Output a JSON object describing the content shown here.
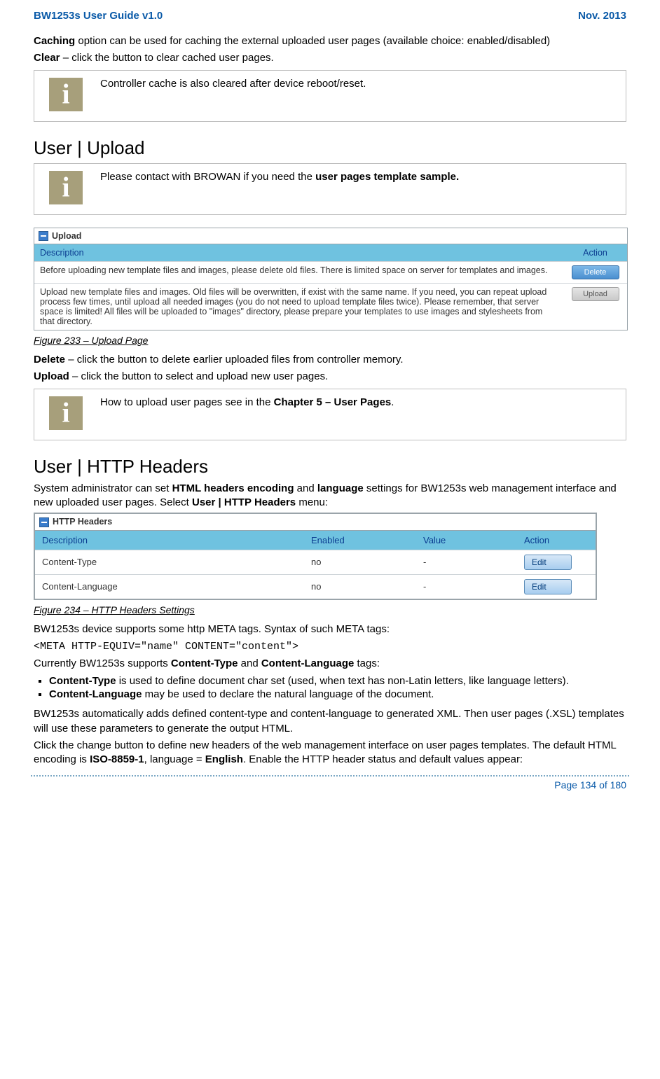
{
  "header": {
    "left": "BW1253s User Guide v1.0",
    "right": "Nov.  2013"
  },
  "intro": {
    "caching_label": "Caching",
    "caching_desc": " option can be used for caching the external uploaded user pages (available choice: enabled/disabled)",
    "clear_label": "Clear",
    "clear_desc": " – click the button to clear cached user pages."
  },
  "info1": "Controller cache is also cleared after device reboot/reset.",
  "upload": {
    "heading": "User | Upload",
    "info_prefix": "Please contact with BROWAN if you need the ",
    "info_bold": "user pages template sample.",
    "panel_title": "Upload",
    "col_desc": "Description",
    "col_action": "Action",
    "row1_text": "Before uploading new template files and images, please delete old files. There is limited space on server for templates and images.",
    "row1_btn": "Delete",
    "row2_text": "Upload new template files and images. Old files will be overwritten, if exist with the same name. If you need, you can repeat upload process few times, until upload all needed images (you do not need to upload template files twice). Please remember, that server space is limited! All files will be uploaded to \"images\" directory, please prepare your templates to use images and stylesheets from that directory.",
    "row2_btn": "Upload",
    "caption": "Figure 233 – Upload Page",
    "delete_label": "Delete",
    "delete_desc": " – click the button to delete earlier uploaded files from controller memory.",
    "upload_label": "Upload",
    "upload_desc": " – click the button to select and upload new user pages.",
    "howto_prefix": "How to upload user pages see in the ",
    "howto_bold": "Chapter 5 – User Pages",
    "howto_suffix": "."
  },
  "http": {
    "heading": "User | HTTP Headers",
    "intro_pre": "System administrator can set ",
    "intro_b1": "HTML headers encoding",
    "intro_mid1": " and ",
    "intro_b2": "language",
    "intro_mid2": " settings for BW1253s web management interface and new uploaded user pages. Select ",
    "intro_b3": "User | HTTP Headers",
    "intro_post": " menu:",
    "panel_title": "HTTP Headers",
    "cols": {
      "desc": "Description",
      "enabled": "Enabled",
      "value": "Value",
      "action": "Action"
    },
    "rows": [
      {
        "desc": "Content-Type",
        "enabled": "no",
        "value": "-",
        "action": "Edit"
      },
      {
        "desc": "Content-Language",
        "enabled": "no",
        "value": "-",
        "action": "Edit"
      }
    ],
    "caption": "Figure 234 – HTTP Headers Settings",
    "meta_intro": "BW1253s device supports some http META tags. Syntax of such META tags:",
    "meta_code": "<META HTTP-EQUIV=\"name\" CONTENT=\"content\">",
    "supports_pre": "Currently BW1253s supports ",
    "supports_b1": "Content-Type",
    "supports_mid": " and ",
    "supports_b2": "Content-Language",
    "supports_post": " tags:",
    "li1_b": "Content-Type",
    "li1_t": " is used to define document char set (used, when text has non-Latin letters, like language letters).",
    "li2_b": "Content-Language",
    "li2_t": " may be used to declare the natural language of the document.",
    "auto_para": "BW1253s automatically adds defined content-type and content-language to generated XML. Then user pages (.XSL) templates will use these parameters to generate the output HTML.",
    "final_pre": "Click the change button to define new headers of the web management interface on user pages templates. The default HTML encoding is ",
    "final_b1": "ISO-8859-1",
    "final_mid": ", language = ",
    "final_b2": "English",
    "final_post": ". Enable the HTTP header status and default values appear:"
  },
  "footer": "Page 134 of 180"
}
